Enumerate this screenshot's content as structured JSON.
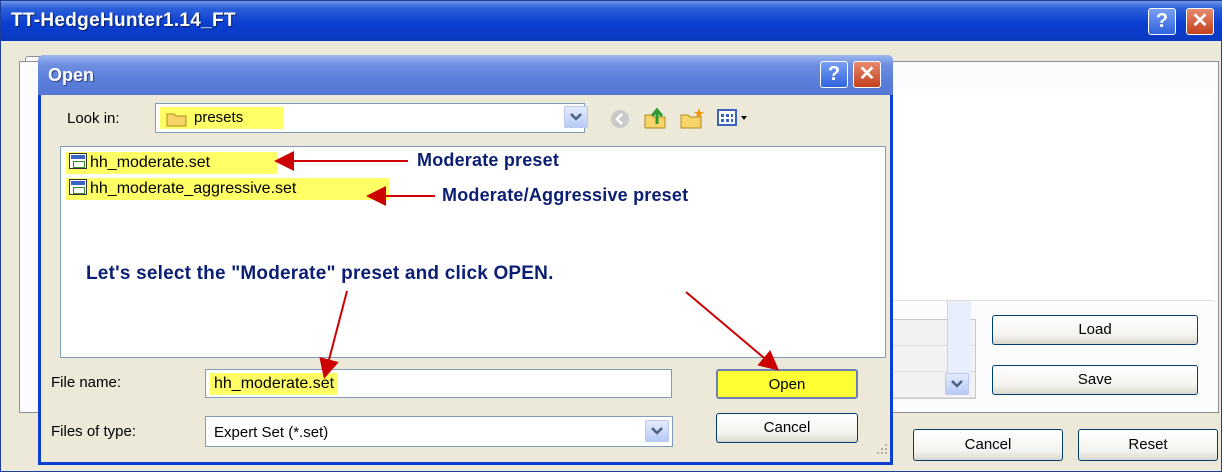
{
  "main_window": {
    "title": "TT-HedgeHunter1.14_FT",
    "buttons": {
      "load": "Load",
      "save": "Save",
      "cancel": "Cancel",
      "reset": "Reset"
    }
  },
  "open_dialog": {
    "title": "Open",
    "look_in_label": "Look in:",
    "look_in_value": "presets",
    "files": [
      "hh_moderate.set",
      "hh_moderate_aggressive.set"
    ],
    "file_name_label": "File name:",
    "file_name_value": "hh_moderate.set",
    "files_of_type_label": "Files of type:",
    "files_of_type_value": "Expert Set (*.set)",
    "open_button": "Open",
    "cancel_button": "Cancel"
  },
  "annotations": {
    "moderate": "Moderate preset",
    "moderate_aggressive": "Moderate/Aggressive preset",
    "instruction": "Let's select the \"Moderate\" preset and click OPEN."
  },
  "colors": {
    "highlight": "#ffff66",
    "arrow": "#cc0000",
    "annotation_text": "#0a1f73",
    "titlebar": "#0a3fd1"
  }
}
